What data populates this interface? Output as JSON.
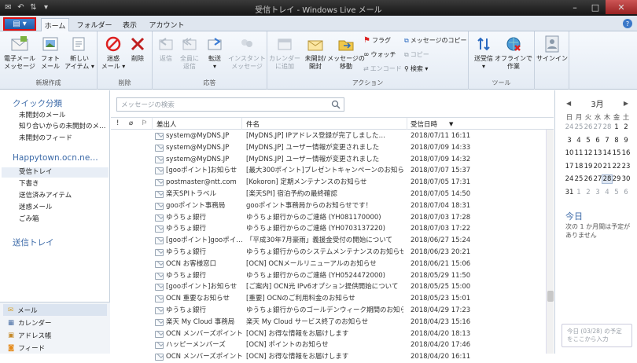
{
  "window": {
    "title": "受信トレイ - Windows Live メール"
  },
  "tabs": [
    "ホーム",
    "フォルダー",
    "表示",
    "アカウント"
  ],
  "ribbon": {
    "groups": [
      {
        "label": "新規作成",
        "buttons": [
          "電子メール\nメッセージ",
          "フォト\nメール",
          "新しい\nアイテム ▾"
        ]
      },
      {
        "label": "削除",
        "buttons": [
          "迷惑\nメール ▾",
          "削除"
        ]
      },
      {
        "label": "応答",
        "buttons": [
          "返信",
          "全員に\n返信",
          "転送\n▾",
          "インスタント\nメッセージ"
        ]
      },
      {
        "label": "アクション",
        "buttons": [
          "カレンダー\nに追加",
          "未開封/\n開封",
          "メッセージの\n移動"
        ],
        "small": [
          "フラグ",
          "ウォッチ",
          "エンコード",
          "メッセージのコピー",
          "コピー",
          "検索 ▾"
        ]
      },
      {
        "label": "ツール",
        "buttons": [
          "送受信\n▾",
          "オフラインで\n作業"
        ]
      },
      {
        "label": "",
        "buttons": [
          "サインイン"
        ]
      }
    ]
  },
  "leftpane": {
    "quick": {
      "title": "クイック分類",
      "items": [
        "未開封のメール",
        "知り合いからの未開封のメ…",
        "未開封のフィード"
      ]
    },
    "account": {
      "title": "Happytown.ocn.ne…",
      "items": [
        "受信トレイ",
        "下書き",
        "送信済みアイテム",
        "迷惑メール",
        "ごみ箱"
      ]
    },
    "outbox": "送信トレイ",
    "nav": [
      "メール",
      "カレンダー",
      "アドレス帳",
      "フィード"
    ]
  },
  "search": {
    "placeholder": "メッセージの検索"
  },
  "columns": {
    "flag1": "!",
    "attach": "⌀",
    "flag2": "⚐",
    "from": "差出人",
    "subject": "件名",
    "date": "受信日時"
  },
  "messages": [
    {
      "from": "system@MyDNS.JP",
      "subject": "[MyDNS.JP] IPアドレス登録が完了しました…",
      "date": "2018/07/11 16:11"
    },
    {
      "from": "system@MyDNS.JP",
      "subject": "[MyDNS.JP] ユーザー情報が変更されました",
      "date": "2018/07/09 14:33"
    },
    {
      "from": "system@MyDNS.JP",
      "subject": "[MyDNS.JP] ユーザー情報が変更されました",
      "date": "2018/07/09 14:32"
    },
    {
      "from": "[gooポイント]お知らせ",
      "subject": "[最大300ポイント]プレゼントキャンペーンのお知らせ",
      "date": "2018/07/07 15:37"
    },
    {
      "from": "postmaster@ntt.com",
      "subject": "[Kokoron] 定期メンテナンスのお知らせ",
      "date": "2018/07/05 17:31"
    },
    {
      "from": "楽天SPIトラベル",
      "subject": "[楽天SPI] 宿泊予約の最終確認",
      "date": "2018/07/05 14:50"
    },
    {
      "from": "gooポイント事務局",
      "subject": "gooポイント事務局からのお知らせです！",
      "date": "2018/07/04 18:31"
    },
    {
      "from": "ゆうちょ銀行",
      "subject": "ゆうちょ銀行からのご連絡 (YH081170000)",
      "date": "2018/07/03 17:28"
    },
    {
      "from": "ゆうちょ銀行",
      "subject": "ゆうちょ銀行からのご連絡 (YH0703137220)",
      "date": "2018/07/03 17:22"
    },
    {
      "from": "[gooポイント]gooポイ…",
      "subject": "「平成30年7月豪雨」義援金受付の開始について",
      "date": "2018/06/27 15:24"
    },
    {
      "from": "ゆうちょ銀行",
      "subject": "ゆうちょ銀行からのシステムメンテナンスのお知らせ",
      "date": "2018/06/23 20:21"
    },
    {
      "from": "OCN お客様窓口",
      "subject": "[OCN] OCNメールリニューアルのお知らせ",
      "date": "2018/06/21 15:06"
    },
    {
      "from": "ゆうちょ銀行",
      "subject": "ゆうちょ銀行からのご連絡 (YH0524472000)",
      "date": "2018/05/29 11:50"
    },
    {
      "from": "[gooポイント]お知らせ",
      "subject": "[ご案内] OCN光 IPv6オプション提供開始について",
      "date": "2018/05/25 15:00"
    },
    {
      "from": "OCN 重要なお知らせ",
      "subject": "[重要] OCNのご利用料金のお知らせ",
      "date": "2018/05/23 15:01"
    },
    {
      "from": "ゆうちょ銀行",
      "subject": "ゆうちょ銀行からのゴールデンウィーク期間のお知らせ",
      "date": "2018/04/29 17:23"
    },
    {
      "from": "楽天 My Cloud 事務局",
      "subject": "楽天 My Cloud サービス終了のお知らせ",
      "date": "2018/04/23 15:16"
    },
    {
      "from": "OCN メンバーズポイント",
      "subject": "[OCN] お得な情報をお届けします",
      "date": "2018/04/20 18:13"
    },
    {
      "from": "ハッピーメンバーズ",
      "subject": "[OCN] ポイントのお知らせ",
      "date": "2018/04/20 17:46"
    },
    {
      "from": "OCN メンバーズポイント",
      "subject": "[OCN] お得な情報をお届けします",
      "date": "2018/04/20 16:11"
    }
  ],
  "calendar": {
    "month": "3月",
    "weekdays": [
      "日",
      "月",
      "火",
      "水",
      "木",
      "金",
      "土"
    ],
    "days": [
      [
        "24",
        "25",
        "26",
        "27",
        "28",
        "1",
        "2"
      ],
      [
        "3",
        "4",
        "5",
        "6",
        "7",
        "8",
        "9"
      ],
      [
        "10",
        "11",
        "12",
        "13",
        "14",
        "15",
        "16"
      ],
      [
        "17",
        "18",
        "19",
        "20",
        "21",
        "22",
        "23"
      ],
      [
        "24",
        "25",
        "26",
        "27",
        "28",
        "29",
        "30"
      ],
      [
        "31",
        "1",
        "2",
        "3",
        "4",
        "5",
        "6"
      ]
    ],
    "today_label": "今日",
    "no_schedule": "次の 1 か月間は予定がありません",
    "add_hint": "今日 (03/28) の予定をここから入力"
  },
  "colors": {
    "accent": "#3c6aa8",
    "titlebar": "#1e1e1e",
    "appmenu": "#2a6ac0"
  }
}
